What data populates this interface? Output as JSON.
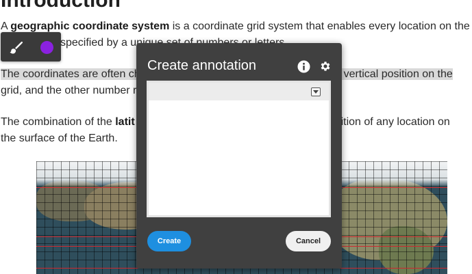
{
  "article": {
    "heading": "Introduction",
    "p1": {
      "pre": "A ",
      "bold": "geographic coordinate system",
      "post_a": " is a coordinate grid system that enables every location on the",
      "post_b": "specified by a unique set of numbers or letters."
    },
    "p2": {
      "a": "The coordinates are often ch",
      "b": "ts vertical position on the",
      "c": "grid, and the other number r"
    },
    "p3": {
      "pre": "The combination of the ",
      "bold": "latit",
      "post_a": "osition of any location on",
      "post_b": "the surface of the Earth."
    }
  },
  "toolbar": {
    "brush_icon": "paintbrush-icon",
    "color": "#8a21e0"
  },
  "dialog": {
    "title": "Create annotation",
    "info_icon": "info-icon",
    "settings_icon": "gear-icon",
    "editor_value": "",
    "create_label": "Create",
    "cancel_label": "Cancel",
    "accent": "#1e8fe0"
  }
}
